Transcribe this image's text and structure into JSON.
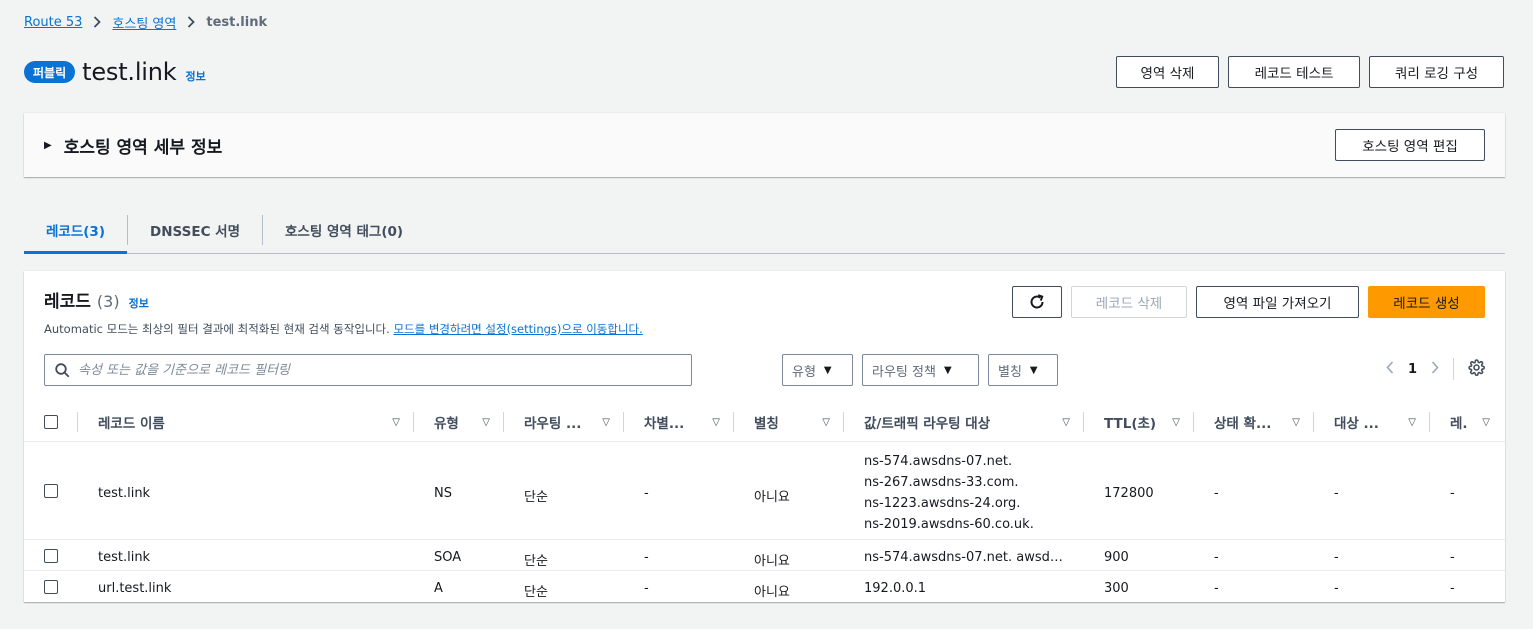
{
  "breadcrumb": {
    "items": [
      "Route 53",
      "호스팅 영역"
    ],
    "current": "test.link"
  },
  "header": {
    "badge": "퍼블릭",
    "title": "test.link",
    "info": "정보",
    "actions": [
      "영역 삭제",
      "레코드 테스트",
      "쿼리 로깅 구성"
    ]
  },
  "details": {
    "title": "호스팅 영역 세부 정보",
    "edit_button": "호스팅 영역 편집"
  },
  "tabs": [
    {
      "label": "레코드(3)",
      "active": true
    },
    {
      "label": "DNSSEC 서명",
      "active": false
    },
    {
      "label": "호스팅 영역 태그(0)",
      "active": false
    }
  ],
  "records": {
    "title": "레코드",
    "count": "(3)",
    "info": "정보",
    "description": "Automatic 모드는 최상의 필터 결과에 최적화된 현재 검색 동작입니다.",
    "description_link": "모드를 변경하려면 설정(settings)으로 이동합니다.",
    "buttons": {
      "delete": "레코드 삭제",
      "import": "영역 파일 가져오기",
      "create": "레코드 생성"
    },
    "search_placeholder": "속성 또는 값을 기준으로 레코드 필터링",
    "filters": [
      "유형",
      "라우팅 정책",
      "별칭"
    ],
    "page": "1"
  },
  "table": {
    "columns": [
      "레코드 이름",
      "유형",
      "라우팅 ...",
      "차별...",
      "별칭",
      "값/트래픽 라우팅 대상",
      "TTL(초)",
      "상태 확...",
      "대상 ...",
      "레."
    ],
    "rows": [
      {
        "name": "test.link",
        "type": "NS",
        "routing": "단순",
        "diff": "-",
        "alias": "아니요",
        "values": [
          "ns-574.awsdns-07.net.",
          "ns-267.awsdns-33.com.",
          "ns-1223.awsdns-24.org.",
          "ns-2019.awsdns-60.co.uk."
        ],
        "ttl": "172800",
        "health": "-",
        "target": "-",
        "rec": "-"
      },
      {
        "name": "test.link",
        "type": "SOA",
        "routing": "단순",
        "diff": "-",
        "alias": "아니요",
        "values": [
          "ns-574.awsdns-07.net. awsd…"
        ],
        "ttl": "900",
        "health": "-",
        "target": "-",
        "rec": "-"
      },
      {
        "name": "url.test.link",
        "type": "A",
        "routing": "단순",
        "diff": "-",
        "alias": "아니요",
        "values": [
          "192.0.0.1"
        ],
        "ttl": "300",
        "health": "-",
        "target": "-",
        "rec": "-"
      }
    ]
  },
  "colors": {
    "accent": "#0972d3",
    "primary_button": "#ff9900",
    "background": "#f2f3f3"
  }
}
